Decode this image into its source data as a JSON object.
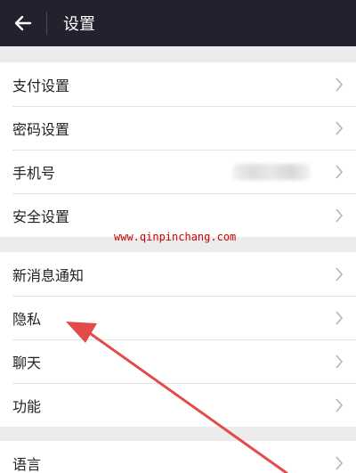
{
  "header": {
    "back_icon": "arrow-left-icon",
    "title": "设置"
  },
  "groups": [
    {
      "items": [
        {
          "label": "支付设置"
        },
        {
          "label": "密码设置"
        },
        {
          "label": "手机号"
        },
        {
          "label": "安全设置"
        }
      ]
    },
    {
      "items": [
        {
          "label": "新消息通知"
        },
        {
          "label": "隐私"
        },
        {
          "label": "聊天"
        },
        {
          "label": "功能"
        }
      ]
    },
    {
      "items": [
        {
          "label": "语言"
        }
      ]
    }
  ],
  "watermark": {
    "text": "www.qinpinchang.com"
  },
  "colors": {
    "header_bg": "#21222d",
    "page_bg": "#ececec",
    "annotation_arrow": "#e34a4a",
    "watermark": "#cc0000"
  }
}
